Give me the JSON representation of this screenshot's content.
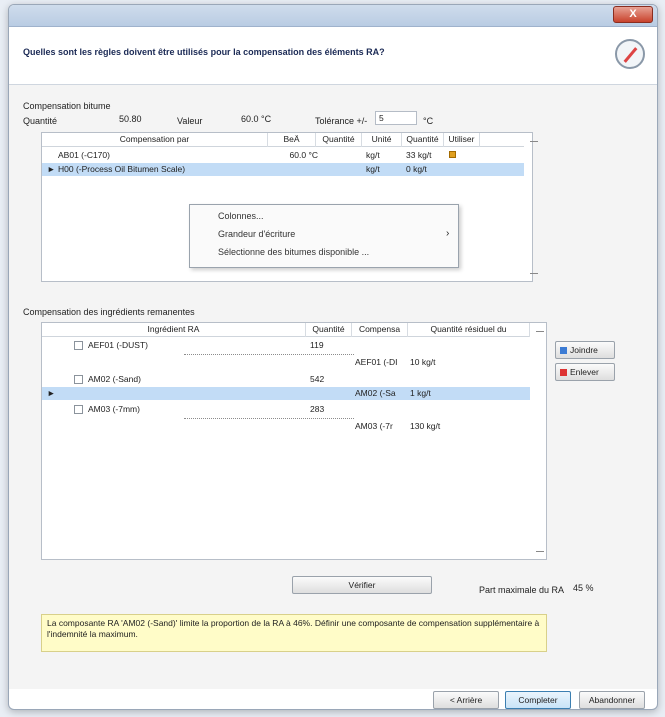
{
  "dialog": {
    "close_label": "X",
    "question": "Quelles sont les règles doivent être utilisés pour la compensation des éléments RA?"
  },
  "bitume": {
    "section_title": "Compensation bitume",
    "quantite_label": "Quantité",
    "quantite_value": "50.80",
    "valeur_label": "Valeur",
    "valeur_value": "60.0 °C",
    "tolerance_label": "Tolérance +/-",
    "tolerance_value": "5",
    "tolerance_unit": "°C",
    "columns": [
      "Compensation par",
      "BeÄ",
      "Quantité",
      "Unité",
      "Quantité",
      "Utiliser"
    ],
    "rows": [
      {
        "marker": "",
        "name": "AB01 (-C170)",
        "bea": "60.0 °C",
        "quantite": "",
        "unite": "kg/t",
        "quantite2": "33 kg/t",
        "utiliser": "pencil"
      },
      {
        "marker": "►",
        "name": "H00 (-Process Oil Bitumen Scale)",
        "bea": "",
        "quantite": "",
        "unite": "kg/t",
        "quantite2": "0 kg/t",
        "utiliser": ""
      }
    ]
  },
  "context_menu": {
    "items": [
      "Colonnes...",
      "Grandeur d'écriture",
      "Sélectionne des bitumes disponible ..."
    ],
    "submenu_arrow": "›"
  },
  "ingredients": {
    "section_title": "Compensation des ingrédients remanentes",
    "columns": [
      "Ingrédient RA",
      "Quantité",
      "Compensa",
      "Quantité résiduel du"
    ],
    "rows": [
      {
        "type": "parent",
        "marker": "",
        "name": "AEF01 (-DUST)",
        "quantite": "119",
        "compensa": "",
        "residuel": ""
      },
      {
        "type": "child",
        "marker": "",
        "name": "",
        "quantite": "",
        "compensa": "AEF01 (-DI",
        "residuel": "10 kg/t"
      },
      {
        "type": "parent",
        "marker": "",
        "name": "AM02 (-Sand)",
        "quantite": "542",
        "compensa": "",
        "residuel": ""
      },
      {
        "type": "child",
        "marker": "►",
        "name": "",
        "quantite": "",
        "compensa": "AM02 (-Sa",
        "residuel": "1 kg/t"
      },
      {
        "type": "parent",
        "marker": "",
        "name": "AM03 (-7mm)",
        "quantite": "283",
        "compensa": "",
        "residuel": ""
      },
      {
        "type": "child",
        "marker": "",
        "name": "",
        "quantite": "",
        "compensa": "AM03 (-7r",
        "residuel": "130 kg/t"
      }
    ],
    "joindre_label": "Joindre",
    "enlever_label": "Enlever"
  },
  "verify": {
    "button_label": "Vérifier",
    "part_label": "Part maximale du RA",
    "part_value": "45 %"
  },
  "message": "La composante RA 'AM02 (-Sand)' limite la proportion de la RA à 46%. Définir une composante de compensation supplémentaire à l'indemnité la maximum.",
  "footer": {
    "back_label": "< Arrière",
    "complete_label": "Completer",
    "cancel_label": "Abandonner"
  },
  "colors": {
    "selection": "#c2dcf6",
    "message_bg": "#fffcc8",
    "close_button": "#c8422c"
  }
}
